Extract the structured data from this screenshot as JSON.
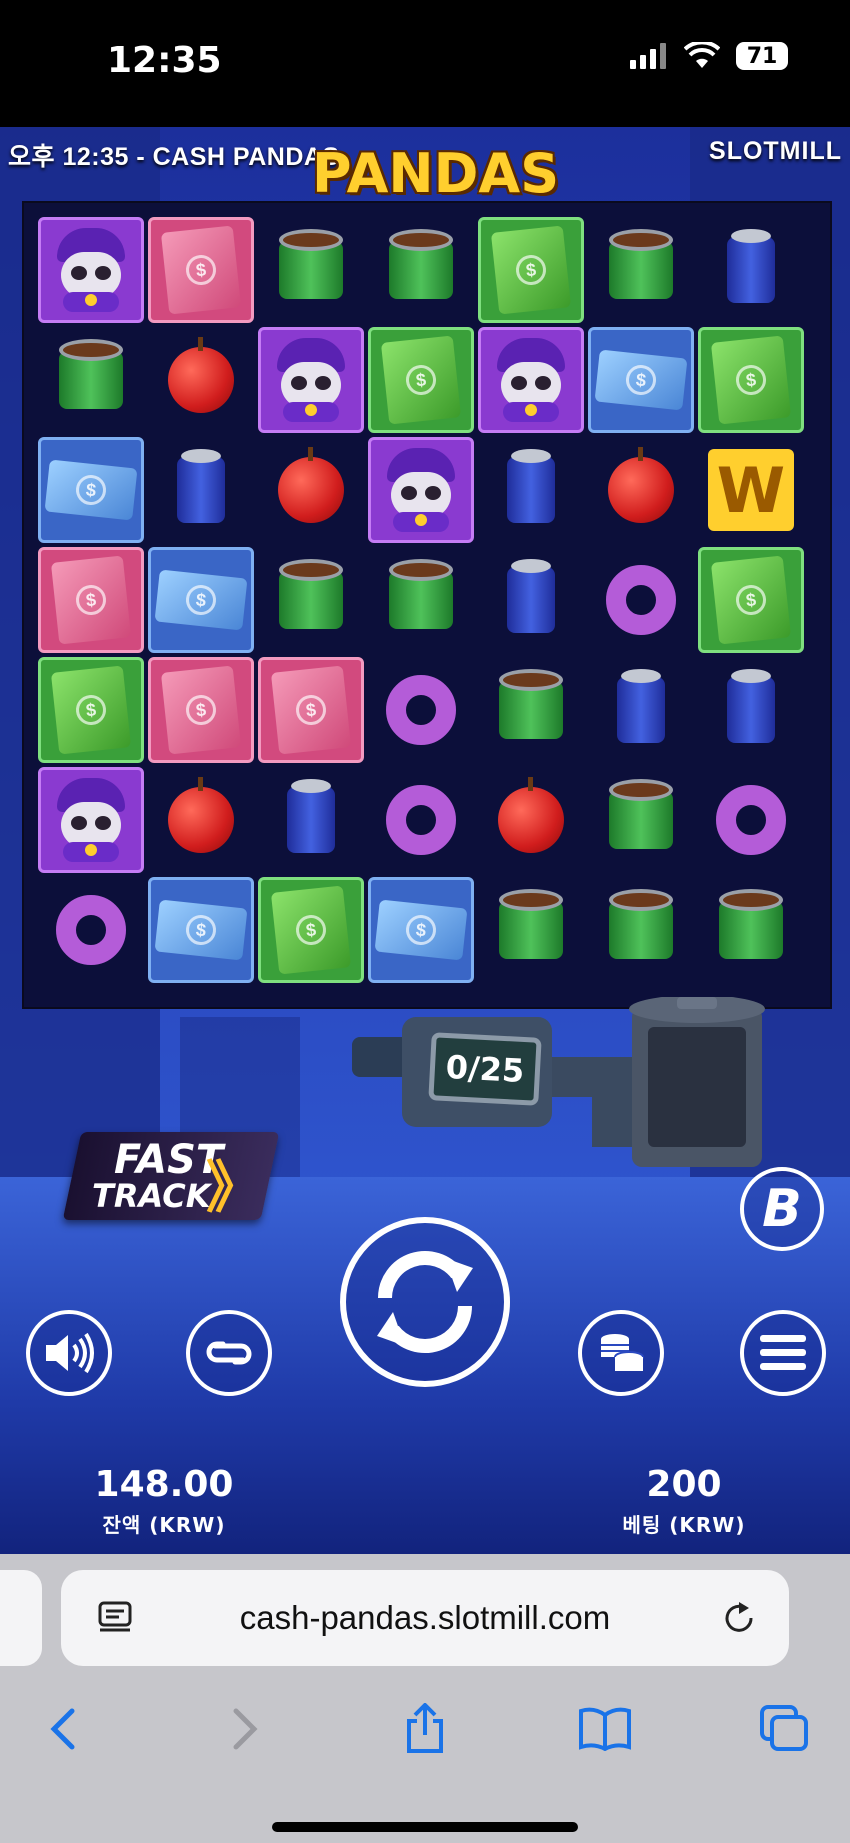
{
  "status_bar": {
    "time": "12:35",
    "battery": "71"
  },
  "game": {
    "header_left": "오후 12:35 - CASH PANDAS",
    "header_right": "SLOTMILL",
    "logo_text": "PANDAS",
    "grid": [
      [
        "panda",
        "bill-pink",
        "can",
        "can",
        "bill-green",
        "can",
        "soda"
      ],
      [
        "can",
        "apple",
        "panda",
        "bill-green",
        "panda",
        "bill-blue",
        "bill-green"
      ],
      [
        "bill-blue",
        "soda",
        "apple",
        "panda",
        "soda",
        "apple",
        "wild"
      ],
      [
        "bill-pink",
        "bill-blue",
        "can",
        "can",
        "soda",
        "donut",
        "bill-green"
      ],
      [
        "bill-green",
        "bill-pink",
        "bill-pink",
        "donut",
        "can",
        "soda",
        "soda"
      ],
      [
        "panda",
        "apple",
        "soda",
        "donut",
        "apple",
        "can",
        "donut"
      ],
      [
        "donut",
        "bill-blue",
        "bill-green",
        "bill-blue",
        "can",
        "can",
        "can"
      ]
    ],
    "wild_letter": "W",
    "meter": "0/25",
    "fast_track": {
      "line1": "FAST",
      "line2": "TRACK",
      "arrows": "》"
    },
    "badge_letter": "B",
    "balance": {
      "value": "148.00",
      "label": "잔액 (KRW)"
    },
    "bet": {
      "value": "200",
      "label": "베팅 (KRW)"
    }
  },
  "browser": {
    "url": "cash-pandas.slotmill.com"
  },
  "colors": {
    "tile_purple": "#8a3ad0",
    "tile_pink": "#d24a7e",
    "tile_green": "#3aa03a",
    "tile_blue": "#3a66c6",
    "safari_blue": "#1a73e8"
  }
}
